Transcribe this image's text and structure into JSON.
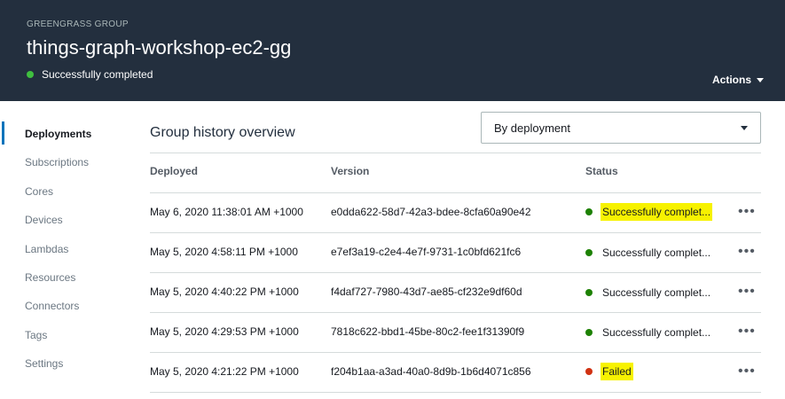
{
  "header": {
    "eyebrow": "GREENGRASS GROUP",
    "title": "things-graph-workshop-ec2-gg",
    "status": "Successfully completed",
    "actions_label": "Actions"
  },
  "sidebar": {
    "items": [
      {
        "label": "Deployments",
        "active": true
      },
      {
        "label": "Subscriptions"
      },
      {
        "label": "Cores"
      },
      {
        "label": "Devices"
      },
      {
        "label": "Lambdas"
      },
      {
        "label": "Resources"
      },
      {
        "label": "Connectors"
      },
      {
        "label": "Tags"
      },
      {
        "label": "Settings"
      }
    ]
  },
  "main": {
    "title": "Group history overview",
    "view_select": "By deployment"
  },
  "table": {
    "columns": [
      "Deployed",
      "Version",
      "Status"
    ],
    "rows": [
      {
        "deployed": "May 6, 2020 11:38:01 AM +1000",
        "version": "e0dda622-58d7-42a3-bdee-8cfa60a90e42",
        "status": "Successfully complet...",
        "status_type": "success",
        "highlighted": true
      },
      {
        "deployed": "May 5, 2020 4:58:11 PM +1000",
        "version": "e7ef3a19-c2e4-4e7f-9731-1c0bfd621fc6",
        "status": "Successfully complet...",
        "status_type": "success",
        "highlighted": false
      },
      {
        "deployed": "May 5, 2020 4:40:22 PM +1000",
        "version": "f4daf727-7980-43d7-ae85-cf232e9df60d",
        "status": "Successfully complet...",
        "status_type": "success",
        "highlighted": false
      },
      {
        "deployed": "May 5, 2020 4:29:53 PM +1000",
        "version": "7818c622-bbd1-45be-80c2-fee1f31390f9",
        "status": "Successfully complet...",
        "status_type": "success",
        "highlighted": false
      },
      {
        "deployed": "May 5, 2020 4:21:22 PM +1000",
        "version": "f204b1aa-a3ad-40a0-8d9b-1b6d4071c856",
        "status": "Failed",
        "status_type": "error",
        "highlighted": true
      }
    ],
    "more_icon": "•••"
  },
  "colors": {
    "header_bg": "#232f3e",
    "success": "#1d8102",
    "error": "#d13212",
    "highlight": "#f7f200",
    "active_nav": "#0073bb"
  }
}
